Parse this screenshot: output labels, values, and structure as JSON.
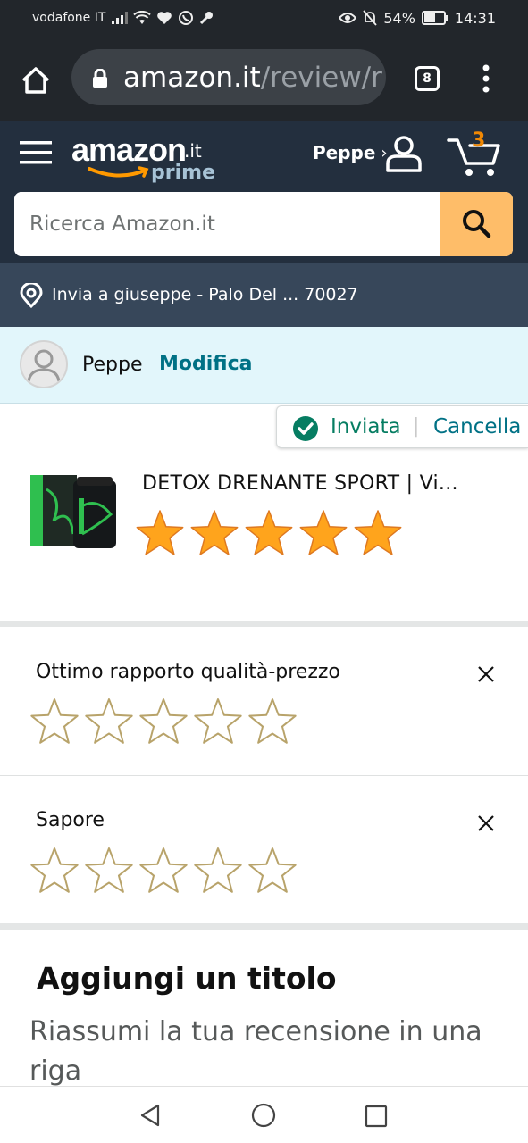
{
  "status_bar": {
    "carrier": "vodafone IT",
    "battery": "54%",
    "time": "14:31"
  },
  "browser": {
    "url_host": "amazon.it",
    "url_path": "/review/r",
    "tab_count": "8"
  },
  "header": {
    "logo_text": "amazon",
    "logo_tld": ".it",
    "logo_prime": "prime",
    "account_name": "Peppe",
    "account_chevron": "›",
    "cart_count": "3"
  },
  "search": {
    "placeholder": "Ricerca Amazon.it",
    "value": ""
  },
  "delivery": {
    "text": "Invia a giuseppe - Palo Del ... 70027"
  },
  "profile": {
    "name": "Peppe",
    "edit_label": "Modifica"
  },
  "review_status": {
    "sent_label": "Inviata",
    "separator": "|",
    "cancel_label": "Cancella"
  },
  "product": {
    "title": "DETOX DRENANTE SPORT | Vi...",
    "rating": 5,
    "rating_max": 5
  },
  "attributes": [
    {
      "label": "Ottimo rapporto qualità-prezzo",
      "rating": 0,
      "rating_max": 5
    },
    {
      "label": "Sapore",
      "rating": 0,
      "rating_max": 5
    }
  ],
  "title_section": {
    "heading": "Aggiungi un titolo",
    "placeholder": "Riassumi la tua recensione in una riga"
  },
  "colors": {
    "header_bg": "#232f3e",
    "delivery_bg": "#37475a",
    "search_button": "#febd69",
    "link_teal": "#007185",
    "success_green": "#067d62",
    "star_fill": "#ffa41c",
    "profile_bg": "#e2f6fb"
  },
  "icons": {
    "home": "home-icon",
    "lock": "lock-icon",
    "search": "search-icon",
    "cart": "cart-icon",
    "location": "location-pin-icon",
    "check": "check-circle-icon",
    "close": "close-icon"
  }
}
